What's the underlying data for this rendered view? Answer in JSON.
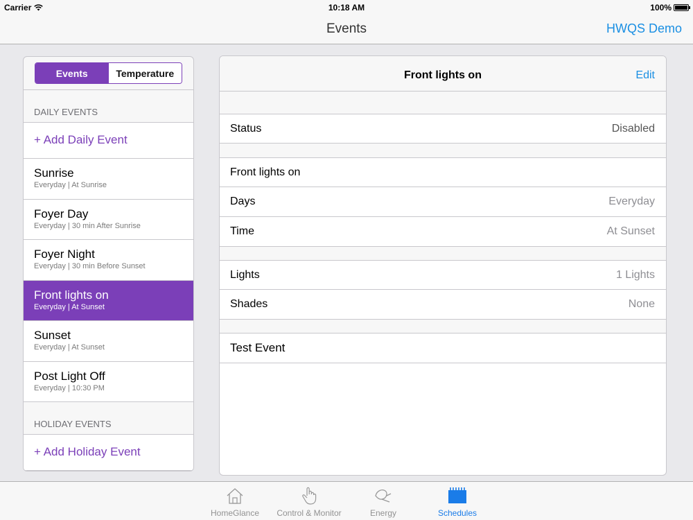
{
  "status_bar": {
    "carrier": "Carrier",
    "time": "10:18 AM",
    "battery": "100%"
  },
  "nav": {
    "title": "Events",
    "right_button": "HWQS Demo"
  },
  "segmented": {
    "selected": "Events",
    "other": "Temperature"
  },
  "daily": {
    "header": "DAILY EVENTS",
    "add_label": "+ Add Daily Event",
    "events": [
      {
        "name": "Sunrise",
        "sub": "Everyday | At Sunrise"
      },
      {
        "name": "Foyer Day",
        "sub": "Everyday | 30 min After Sunrise"
      },
      {
        "name": "Foyer Night",
        "sub": "Everyday | 30 min Before Sunset"
      },
      {
        "name": "Front lights on",
        "sub": "Everyday | At Sunset"
      },
      {
        "name": "Sunset",
        "sub": "Everyday | At Sunset"
      },
      {
        "name": "Post Light Off",
        "sub": "Everyday | 10:30 PM"
      }
    ]
  },
  "holiday": {
    "header": "HOLIDAY EVENTS",
    "add_label": "+ Add Holiday Event"
  },
  "detail": {
    "title": "Front lights on",
    "edit_label": "Edit",
    "status_label": "Status",
    "status_value": "Disabled",
    "event_name": "Front lights on",
    "days_label": "Days",
    "days_value": "Everyday",
    "time_label": "Time",
    "time_value": "At Sunset",
    "lights_label": "Lights",
    "lights_value": "1 Lights",
    "shades_label": "Shades",
    "shades_value": "None",
    "test_label": "Test Event"
  },
  "tabs": [
    {
      "label": "HomeGlance",
      "icon": "house-icon"
    },
    {
      "label": "Control & Monitor",
      "icon": "hand-pointer-icon"
    },
    {
      "label": "Energy",
      "icon": "energy-leaf-icon"
    },
    {
      "label": "Schedules",
      "icon": "calendar-icon"
    }
  ],
  "colors": {
    "accent_purple": "#7b3fb8",
    "link_blue": "#1a8fe3",
    "tab_active": "#1a7ce8"
  }
}
